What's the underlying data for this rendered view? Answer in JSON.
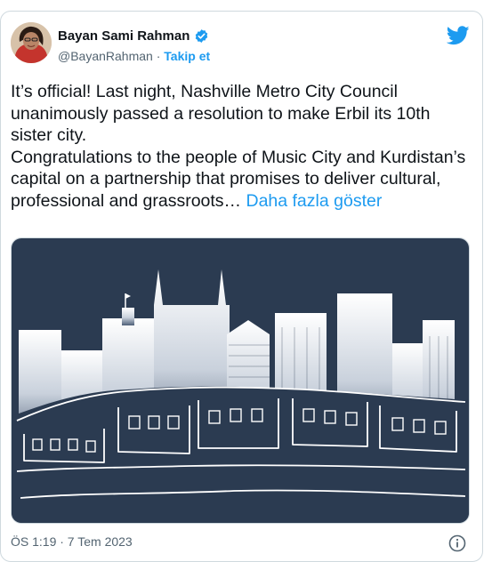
{
  "tweet": {
    "author_name": "Bayan Sami Rahman",
    "handle": "@BayanRahman",
    "separator": "·",
    "follow_label": "Takip et",
    "paragraphs": [
      "It’s official! Last night, Nashville Metro City Council unanimously passed a resolution to make Erbil its 10th sister city.",
      "Congratulations to the people of Music City and Kurdistan’s capital on a partnership that promises to deliver cultural,",
      "professional and grassroots…"
    ],
    "show_more_label": "Daha fazla göster",
    "timestamp": "ÖS 1:19 · 7 Tem 2023",
    "icons": {
      "verified": "verified-badge-icon",
      "platform": "twitter-bird-icon",
      "info": "info-icon"
    },
    "colors": {
      "accent": "#1d9bf0",
      "media_background": "#2b3b51"
    }
  }
}
